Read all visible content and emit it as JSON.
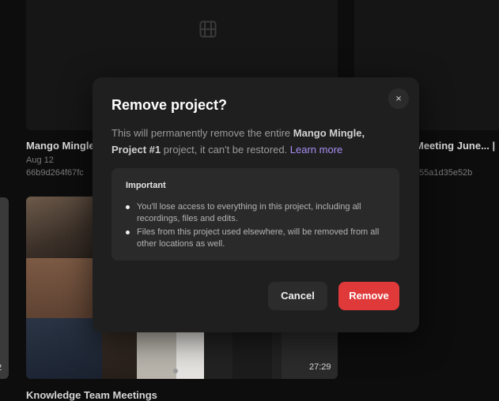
{
  "background": {
    "cards": [
      {
        "title": "Mango Mingle",
        "date": "Aug 12",
        "id": "66b9d264f67fc"
      },
      {
        "title": "Meeting June... |",
        "id": "55a1d35e52b"
      },
      {
        "title": "Knowledge Team Meetings",
        "duration": "27:29"
      }
    ],
    "left_card_time": "2"
  },
  "modal": {
    "title": "Remove project?",
    "close_icon": "×",
    "description": {
      "prefix": "This will permanently remove the entire ",
      "project_name_1": "Mango Mingle",
      "comma": ",",
      "project_name_2": "Project #1",
      "suffix": " project, it can't be restored. ",
      "learn_more": "Learn more"
    },
    "important": {
      "heading": "Important",
      "bullets": [
        "You'll lose access to everything in this project, including all recordings, files and edits.",
        "Files from this project used elsewhere, will be removed from all other locations as well."
      ]
    },
    "cancel_label": "Cancel",
    "remove_label": "Remove"
  },
  "colors": {
    "accent_link": "#a88ef3",
    "danger": "#e0393a",
    "modal_bg": "#1f1f1f"
  }
}
